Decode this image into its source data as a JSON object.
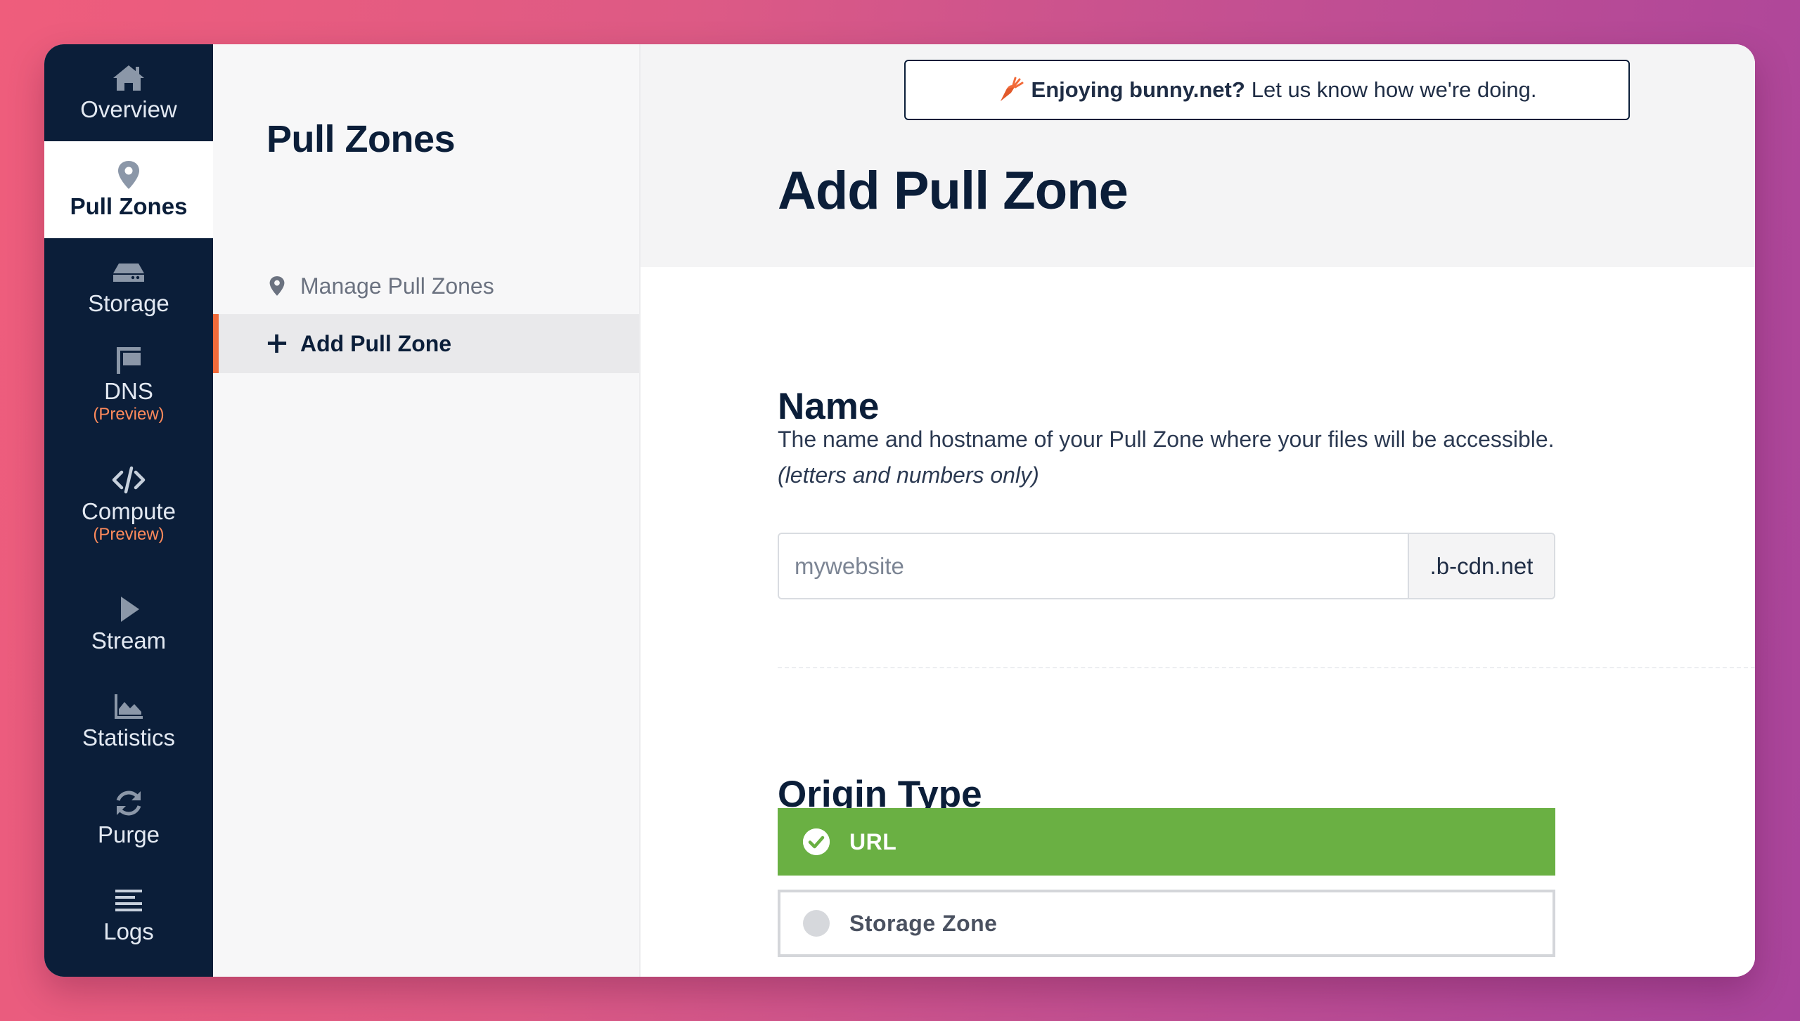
{
  "nav": {
    "items": [
      {
        "label": "Overview",
        "sub": "",
        "icon": "home-icon"
      },
      {
        "label": "Pull Zones",
        "sub": "",
        "icon": "map-pin-icon"
      },
      {
        "label": "Storage",
        "sub": "",
        "icon": "hard-drive-icon"
      },
      {
        "label": "DNS",
        "sub": "(Preview)",
        "icon": "signpost-icon"
      },
      {
        "label": "Compute",
        "sub": "(Preview)",
        "icon": "code-icon"
      },
      {
        "label": "Stream",
        "sub": "",
        "icon": "play-icon"
      },
      {
        "label": "Statistics",
        "sub": "",
        "icon": "area-chart-icon"
      },
      {
        "label": "Purge",
        "sub": "",
        "icon": "refresh-icon"
      },
      {
        "label": "Logs",
        "sub": "",
        "icon": "list-lines-icon"
      }
    ],
    "active": "Pull Zones"
  },
  "subnav": {
    "title": "Pull Zones",
    "items": [
      {
        "label": "Manage Pull Zones",
        "icon": "map-pin-icon"
      },
      {
        "label": "Add Pull Zone",
        "icon": "plus-icon"
      }
    ]
  },
  "feedback": {
    "bold": "Enjoying bunny.net?",
    "text": "Let us know how we're doing.",
    "icon": "carrot-icon"
  },
  "page": {
    "title": "Add Pull Zone"
  },
  "name_section": {
    "title": "Name",
    "description": "The name and hostname of your Pull Zone where your files will be accessible.",
    "description_note": "(letters and numbers only)",
    "placeholder": "mywebsite",
    "value": "",
    "suffix": ".b-cdn.net"
  },
  "origin_section": {
    "title": "Origin Type",
    "options": [
      {
        "label": "URL",
        "selected": true
      },
      {
        "label": "Storage Zone",
        "selected": false
      }
    ]
  },
  "colors": {
    "nav_bg": "#0b1e39",
    "accent_orange": "#f26b3a",
    "selected_green": "#6ab043",
    "preview_orange": "#ff8a5b"
  }
}
